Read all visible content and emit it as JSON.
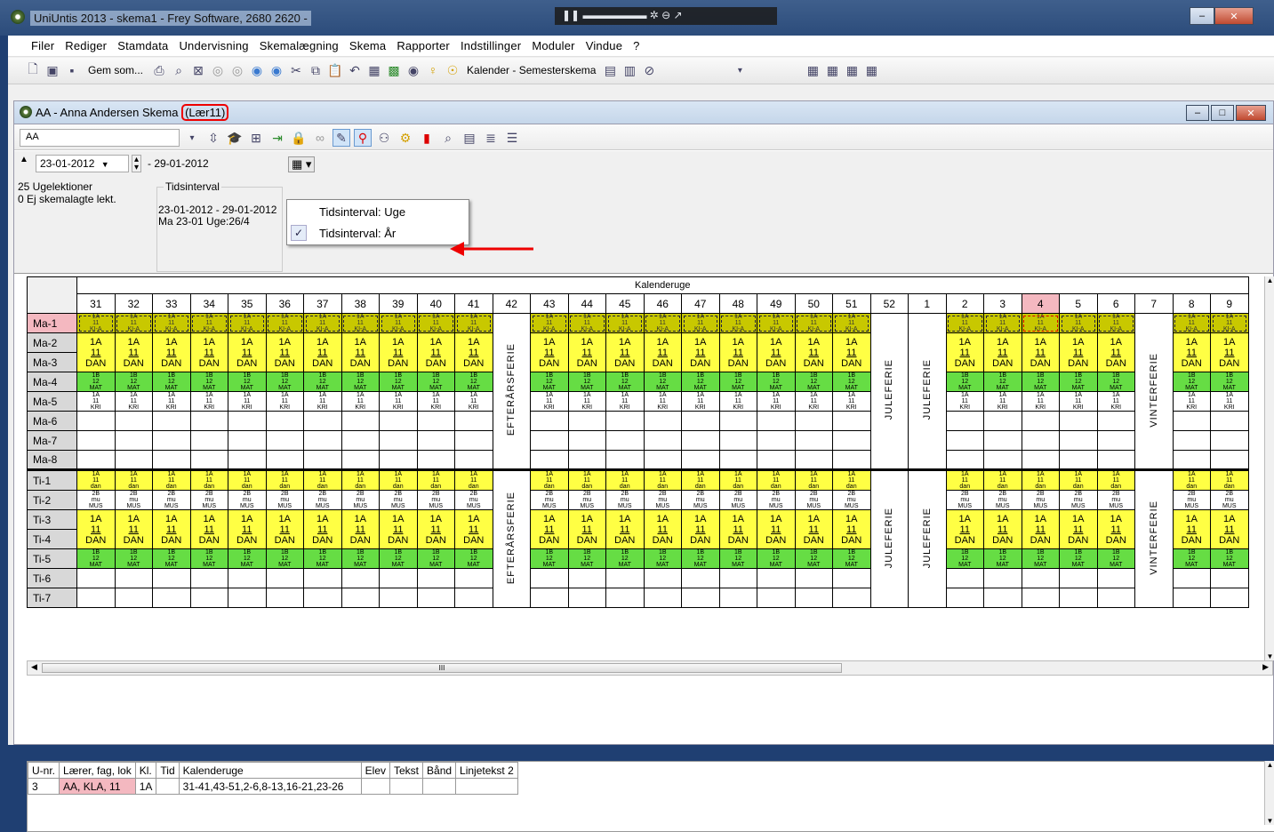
{
  "window": {
    "title": "UniUntis 2013 - skema1 - Frey Software, 2680 2620 -",
    "min": "–",
    "max": "□",
    "close": "✕"
  },
  "menu": [
    "Filer",
    "Rediger",
    "Stamdata",
    "Undervisning",
    "Skemalægning",
    "Skema",
    "Rapporter",
    "Indstillinger",
    "Moduler",
    "Vindue",
    "?"
  ],
  "toolbar": {
    "save_as": "Gem som...",
    "calendar_label": "Kalender - Semesterskema"
  },
  "child": {
    "title": "AA - Anna Andersen  Skema",
    "tag": "(Lær11)",
    "teacher_select": "AA"
  },
  "info": {
    "date_from": "23-01-2012",
    "date_to": "- 29-01-2012",
    "lessons_week": "25 Ugelektioner",
    "lessons_unscheduled": "0  Ej skemalagte lekt.",
    "interval_group": "Tidsinterval",
    "interval_range": "23-01-2012 - 29-01-2012",
    "interval_day": "Ma 23-01  Uge:26/4"
  },
  "dropdown": {
    "opt1": "Tidsinterval: Uge",
    "opt2": "Tidsinterval: År",
    "check": "✓"
  },
  "grid": {
    "caption": "Kalenderuge",
    "weeks": [
      "31",
      "32",
      "33",
      "34",
      "35",
      "36",
      "37",
      "38",
      "39",
      "40",
      "41",
      "42",
      "43",
      "44",
      "45",
      "46",
      "47",
      "48",
      "49",
      "50",
      "51",
      "52",
      "1",
      "2",
      "3",
      "4",
      "5",
      "6",
      "7",
      "8",
      "9"
    ],
    "highlight_week": "4",
    "rows": [
      "Ma-1",
      "Ma-2",
      "Ma-3",
      "Ma-4",
      "Ma-5",
      "Ma-6",
      "Ma-7",
      "Ma-8",
      "Ti-1",
      "Ti-2",
      "Ti-3",
      "Ti-4",
      "Ti-5",
      "Ti-6",
      "Ti-7"
    ],
    "holidays": {
      "w42": "EFTERÅRSFERIE",
      "w52": "JULEFERIE",
      "w1": "JULEFERIE",
      "w7": "VINTERFERIE"
    },
    "cells": {
      "ma1": [
        "1A",
        "11",
        "KI-A"
      ],
      "dan": [
        "1A",
        "11",
        "DAN"
      ],
      "mat": [
        "1B",
        "12",
        "MAT"
      ],
      "kri": [
        "1A",
        "11",
        "KRI"
      ],
      "ti1": [
        "1A",
        "11",
        "dan"
      ],
      "mus": [
        "2B",
        "mu",
        "MUS"
      ]
    },
    "hscroll_mark": "III"
  },
  "bottom": {
    "headers": [
      "U-nr.",
      "Lærer, fag, lok",
      "Kl.",
      "Tid",
      "Kalenderuge",
      "Elev",
      "Tekst",
      "Bånd",
      "Linjetekst 2"
    ],
    "row": [
      "3",
      "AA, KLA, 11",
      "1A",
      "",
      "31-41,43-51,2-6,8-13,16-21,23-26",
      "",
      "",
      "",
      ""
    ]
  }
}
